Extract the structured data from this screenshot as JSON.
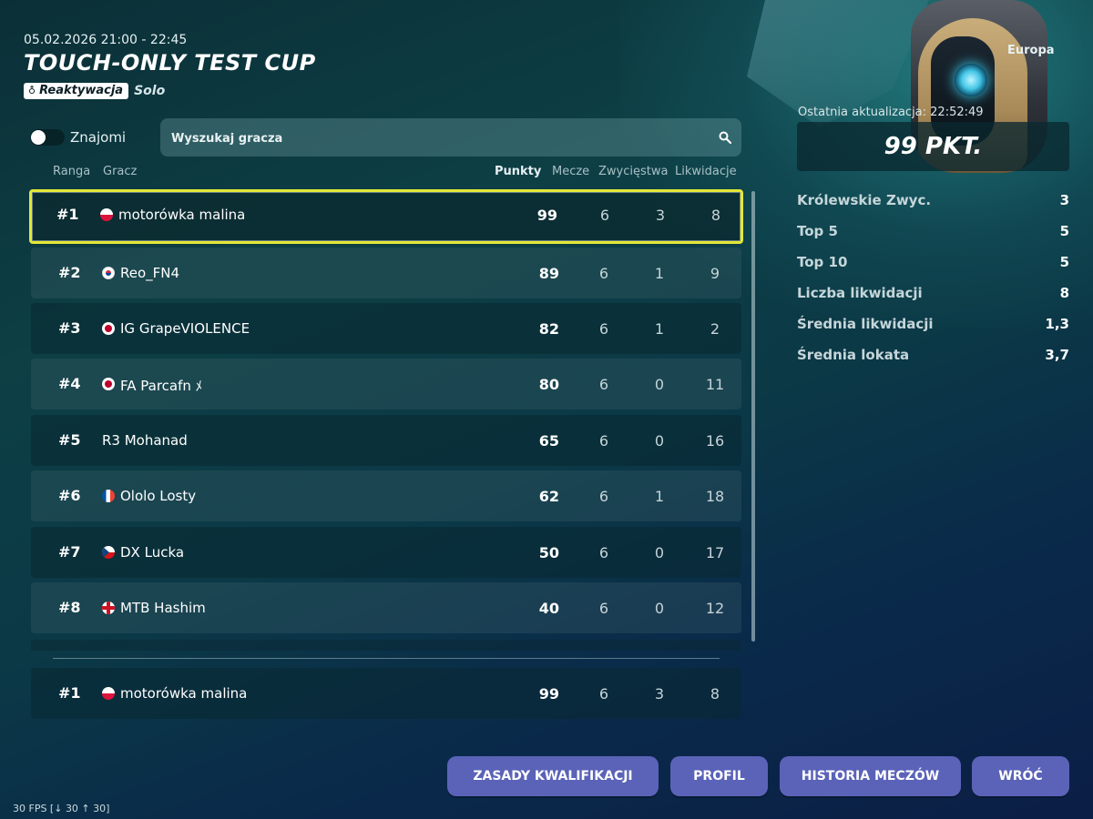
{
  "header": {
    "date": "05.02.2026 21:00 - 22:45",
    "title": "TOUCH-ONLY TEST CUP",
    "tag": "Reaktywacja",
    "mode": "Solo"
  },
  "filters": {
    "toggle_label": "Znajomi",
    "search_placeholder": "Wyszukaj gracza"
  },
  "columns": {
    "rank": "Ranga",
    "player": "Gracz",
    "points": "Punkty",
    "matches": "Mecze",
    "wins": "Zwycięstwa",
    "eliminations": "Likwidacje"
  },
  "rows": [
    {
      "rank": "#1",
      "flag": "pl",
      "name": "motorówka malina",
      "points": "99",
      "matches": "6",
      "wins": "3",
      "elims": "8"
    },
    {
      "rank": "#2",
      "flag": "kr",
      "name": "Reo_FN4",
      "points": "89",
      "matches": "6",
      "wins": "1",
      "elims": "9"
    },
    {
      "rank": "#3",
      "flag": "jp",
      "name": "IG GrapeVIOLENCE",
      "points": "82",
      "matches": "6",
      "wins": "1",
      "elims": "2"
    },
    {
      "rank": "#4",
      "flag": "jp",
      "name": "FA Parcafn ﾒ",
      "points": "80",
      "matches": "6",
      "wins": "0",
      "elims": "11"
    },
    {
      "rank": "#5",
      "flag": "",
      "name": "R3 Mohanad",
      "points": "65",
      "matches": "6",
      "wins": "0",
      "elims": "16"
    },
    {
      "rank": "#6",
      "flag": "fr",
      "name": "Ololo Losty",
      "points": "62",
      "matches": "6",
      "wins": "1",
      "elims": "18"
    },
    {
      "rank": "#7",
      "flag": "cz",
      "name": "DX Lucka",
      "points": "50",
      "matches": "6",
      "wins": "0",
      "elims": "17"
    },
    {
      "rank": "#8",
      "flag": "en",
      "name": "MTB Hashim",
      "points": "40",
      "matches": "6",
      "wins": "0",
      "elims": "12"
    }
  ],
  "self_row": {
    "rank": "#1",
    "flag": "pl",
    "name": "motorówka malina",
    "points": "99",
    "matches": "6",
    "wins": "3",
    "elims": "8"
  },
  "sidebar": {
    "region": "Europa",
    "last_update": "Ostatnia aktualizacja: 22:52:49",
    "points_display": "99 PKT.",
    "stats": [
      {
        "label": "Królewskie Zwyc.",
        "value": "3"
      },
      {
        "label": "Top 5",
        "value": "5"
      },
      {
        "label": "Top 10",
        "value": "5"
      },
      {
        "label": "Liczba likwidacji",
        "value": "8"
      },
      {
        "label": "Średnia likwidacji",
        "value": "1,3"
      },
      {
        "label": "Średnia lokata",
        "value": "3,7"
      }
    ]
  },
  "buttons": {
    "rules": "ZASADY KWALIFIKACJI",
    "profile": "PROFIL",
    "history": "HISTORIA MECZÓW",
    "back": "WRÓĆ"
  },
  "fps": "30 FPS [↓ 30 ↑ 30]",
  "colors": {
    "highlight_border": "#e4e836",
    "button_bg": "#5a63b8"
  }
}
